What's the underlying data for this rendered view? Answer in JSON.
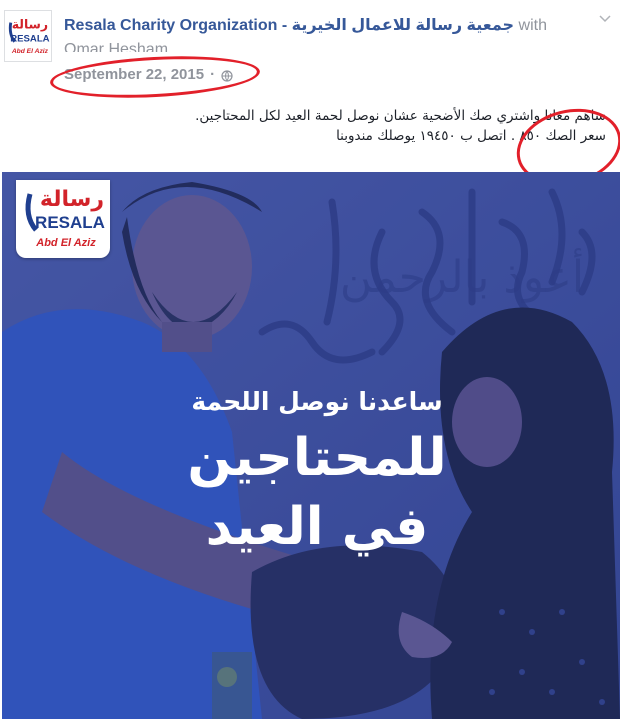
{
  "post": {
    "page_name": "Resala Charity Organization -",
    "page_name_ar": "جمعية رسالة للاعمال الخيرية",
    "with_word": "with",
    "tagged_user": "Omar Hesham.",
    "date": "September 22, 2015",
    "separator": "·",
    "privacy_icon": "globe-icon",
    "text_lines": [
      "ساهم معانا واشتري صك الأضحية عشان نوصل لحمة العيد لكل المحتاجين.",
      "سعر الصك ٨٥٠ . اتصل ب ١٩٤٥٠ يوصلك مندوبنا"
    ]
  },
  "logo": {
    "arabic": "رسالة",
    "latin": "RESALA",
    "sub": "Abd El Aziz"
  },
  "photo": {
    "overlay_line1": "ساعدنا نوصل اللحمة",
    "overlay_line2": "للمحتاجين",
    "overlay_line3": "في العيد",
    "wall_text": "أعوذ بالرحمن"
  },
  "colors": {
    "link": "#365899",
    "meta": "#90949c",
    "annotation_circle": "#e2202a",
    "photo_tint": "#3b4fa0",
    "brand_red": "#d2232a",
    "brand_blue": "#1f3f8f"
  }
}
